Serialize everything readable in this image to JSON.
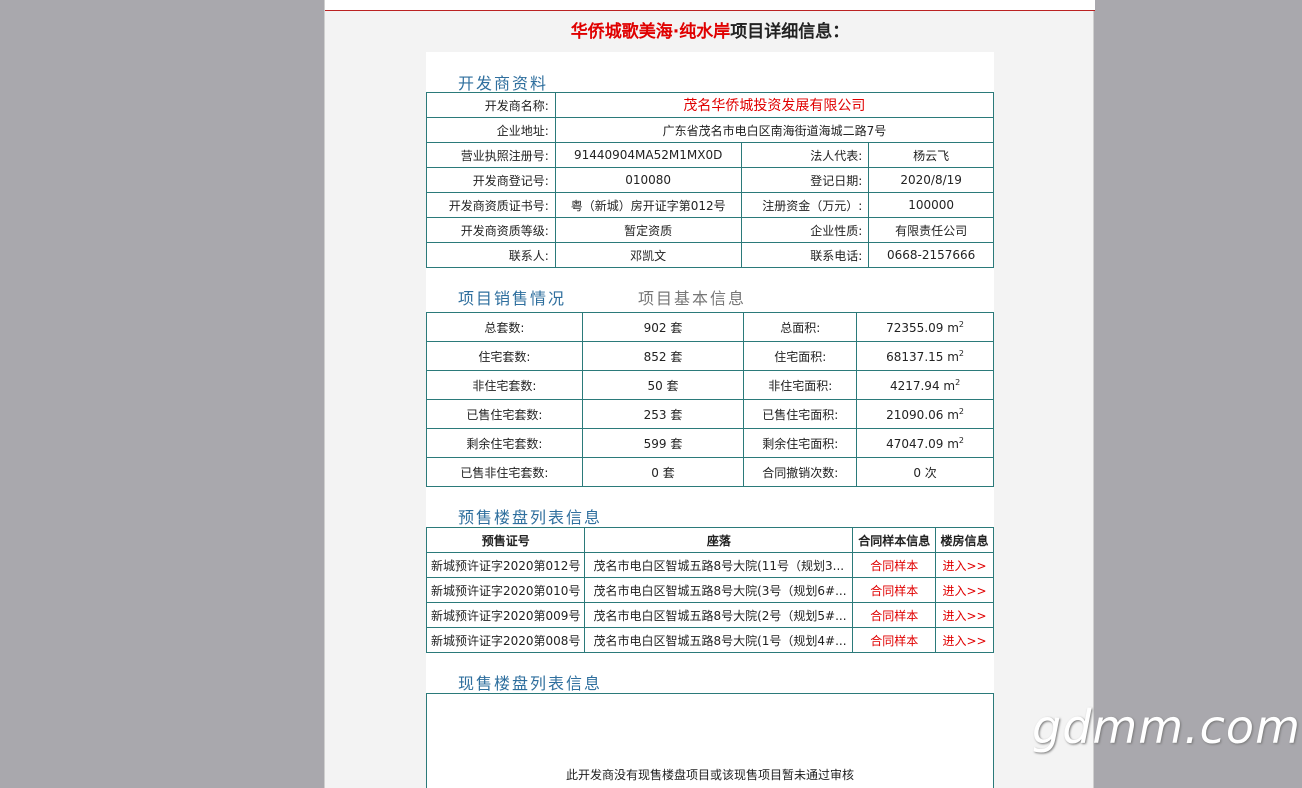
{
  "page": {
    "title_red": "华侨城歌美海·纯水岸",
    "title_rest": "项目详细信息："
  },
  "developer": {
    "section_title": "开发商资料",
    "rows": [
      {
        "label": "开发商名称:",
        "value": "茂名华侨城投资发展有限公司"
      },
      {
        "label": "企业地址:",
        "value": "广东省茂名市电白区南海街道海城二路7号"
      },
      {
        "label": "营业执照注册号:",
        "value": "91440904MA52M1MX0D",
        "label2": "法人代表:",
        "value2": "杨云飞"
      },
      {
        "label": "开发商登记号:",
        "value": "010080",
        "label2": "登记日期:",
        "value2": "2020/8/19"
      },
      {
        "label": "开发商资质证书号:",
        "value": "粤（新城）房开证字第012号",
        "label2": "注册资金（万元）:",
        "value2": "100000"
      },
      {
        "label": "开发商资质等级:",
        "value": "暂定资质",
        "label2": "企业性质:",
        "value2": "有限责任公司"
      },
      {
        "label": "联系人:",
        "value": "邓凯文",
        "label2": "联系电话:",
        "value2": "0668-2157666"
      }
    ]
  },
  "sales": {
    "tab_active": "项目销售情况",
    "tab_inactive": "项目基本信息",
    "rows": [
      {
        "label": "总套数:",
        "value": "902 套",
        "label2": "总面积:",
        "value2": "72355.09 m",
        "sup": "2"
      },
      {
        "label": "住宅套数:",
        "value": "852 套",
        "label2": "住宅面积:",
        "value2": "68137.15 m",
        "sup": "2"
      },
      {
        "label": "非住宅套数:",
        "value": "50 套",
        "label2": "非住宅面积:",
        "value2": "4217.94 m",
        "sup": "2"
      },
      {
        "label": "已售住宅套数:",
        "value": "253 套",
        "label2": "已售住宅面积:",
        "value2": "21090.06 m",
        "sup": "2"
      },
      {
        "label": "剩余住宅套数:",
        "value": "599 套",
        "label2": "剩余住宅面积:",
        "value2": "47047.09 m",
        "sup": "2"
      },
      {
        "label": "已售非住宅套数:",
        "value": "0 套",
        "label2": "合同撤销次数:",
        "value2": "0 次",
        "sup": ""
      }
    ]
  },
  "presale": {
    "section_title": "预售楼盘列表信息",
    "headers": [
      "预售证号",
      "座落",
      "合同样本信息",
      "楼房信息"
    ],
    "rows": [
      {
        "cert": "新城预许证字2020第012号",
        "location": "茂名市电白区智城五路8号大院(11号（规划3...",
        "contract": "合同样本",
        "enter": "进入>>"
      },
      {
        "cert": "新城预许证字2020第010号",
        "location": "茂名市电白区智城五路8号大院(3号（规划6#...",
        "contract": "合同样本",
        "enter": "进入>>"
      },
      {
        "cert": "新城预许证字2020第009号",
        "location": "茂名市电白区智城五路8号大院(2号（规划5#...",
        "contract": "合同样本",
        "enter": "进入>>"
      },
      {
        "cert": "新城预许证字2020第008号",
        "location": "茂名市电白区智城五路8号大院(1号（规划4#...",
        "contract": "合同样本",
        "enter": "进入>>"
      }
    ]
  },
  "current_sale": {
    "section_title": "现售楼盘列表信息",
    "empty_text": "此开发商没有现售楼盘项目或该现售项目暂未通过审核"
  },
  "watermark": "gdmm.com"
}
